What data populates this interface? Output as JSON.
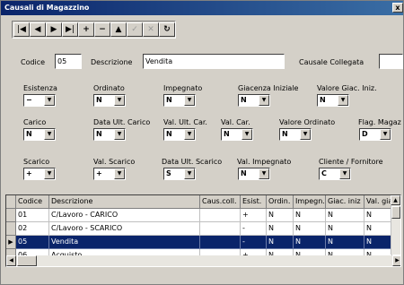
{
  "window": {
    "title": "Causali di Magazzino",
    "close_label": "x"
  },
  "toolbar": {
    "buttons": [
      {
        "glyph": "|◀"
      },
      {
        "glyph": "◀"
      },
      {
        "glyph": "▶"
      },
      {
        "glyph": "▶|"
      },
      {
        "glyph": "+"
      },
      {
        "glyph": "−"
      },
      {
        "glyph": "▲"
      },
      {
        "glyph": "✓"
      },
      {
        "glyph": "✕"
      },
      {
        "glyph": "↻"
      }
    ]
  },
  "form": {
    "codice_label": "Codice",
    "codice_value": "05",
    "descrizione_label": "Descrizione",
    "descrizione_value": "Vendita",
    "causale_collegata_label": "Causale Collegata",
    "causale_collegata_value": "",
    "fields": [
      {
        "label": "Esistenza",
        "value": "−"
      },
      {
        "label": "Ordinato",
        "value": "N"
      },
      {
        "label": "Impegnato",
        "value": "N"
      },
      {
        "label": "Giacenza Iniziale",
        "value": "N"
      },
      {
        "label": "Valore Giac. Iniz.",
        "value": "N"
      },
      {
        "label": "Carico",
        "value": "N"
      },
      {
        "label": "Data Ult. Carico",
        "value": "N"
      },
      {
        "label": "Val. Ult. Car.",
        "value": "N"
      },
      {
        "label": "Val. Car.",
        "value": "N"
      },
      {
        "label": "Valore Ordinato",
        "value": "N"
      },
      {
        "label": "Flag. Magaz",
        "value": "D"
      },
      {
        "label": "Scarico",
        "value": "+"
      },
      {
        "label": "Val. Scarico",
        "value": "+"
      },
      {
        "label": "Data Ult. Scarico",
        "value": "S"
      },
      {
        "label": "Val. Impegnato",
        "value": "N"
      },
      {
        "label": "Cliente / Fornitore",
        "value": "C"
      }
    ]
  },
  "table": {
    "headers": [
      "Codice",
      "Descrizione",
      "Caus.coll.",
      "Esist.",
      "Ordin.",
      "Impegn.",
      "Giac. iniz",
      "Val. giac"
    ],
    "rows": [
      {
        "cells": [
          "01",
          "C/Lavoro - CARICO",
          "",
          "+",
          "N",
          "N",
          "N",
          "N"
        ]
      },
      {
        "cells": [
          "02",
          "C/Lavoro - SCARICO",
          "",
          "-",
          "N",
          "N",
          "N",
          "N"
        ]
      },
      {
        "cells": [
          "05",
          "Vendita",
          "",
          "-",
          "N",
          "N",
          "N",
          "N"
        ]
      },
      {
        "cells": [
          "06",
          "Acquisto",
          "",
          "+",
          "N",
          "N",
          "N",
          "N"
        ]
      }
    ],
    "selected_row_index": 2,
    "row_pointer": "▶"
  },
  "icons": {
    "dropdown": "chevron-down-icon"
  }
}
